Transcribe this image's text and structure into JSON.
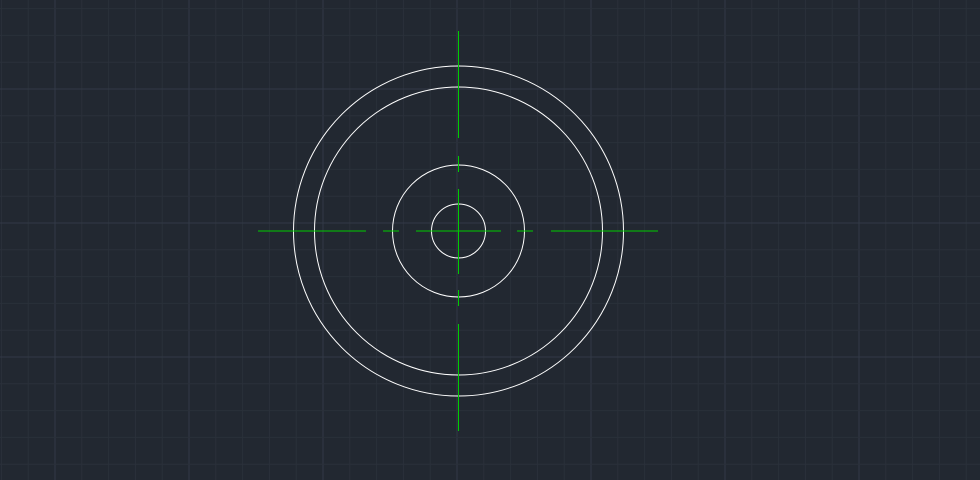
{
  "canvas": {
    "background": "#222831",
    "grid_minor_color": "#2a303a",
    "grid_major_color": "#323946",
    "geometry_color": "#ffffff",
    "centerline_color": "#00cc00"
  },
  "drawing": {
    "entities": [
      {
        "type": "circle",
        "name": "outer-circle",
        "layer": "geometry"
      },
      {
        "type": "circle",
        "name": "second-circle",
        "layer": "geometry"
      },
      {
        "type": "circle",
        "name": "hub-circle",
        "layer": "geometry"
      },
      {
        "type": "circle",
        "name": "bore-circle",
        "layer": "geometry"
      },
      {
        "type": "centerline",
        "name": "horizontal-centerline",
        "layer": "centerline"
      },
      {
        "type": "centerline",
        "name": "vertical-centerline",
        "layer": "centerline"
      }
    ]
  }
}
